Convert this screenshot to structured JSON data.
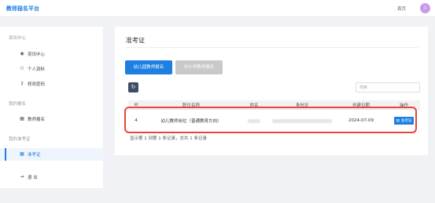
{
  "app": {
    "title": "教师报名平台"
  },
  "topbar": {
    "home_label": "首页",
    "avatar_initial": "I",
    "avatar_color": "#c79be8"
  },
  "sidebar": {
    "sections": [
      {
        "label": "资讯中心"
      },
      {
        "label": "我的报名"
      },
      {
        "label": "我的准考证"
      }
    ],
    "items": [
      {
        "label": "资讯中心",
        "icon": "user-circle-icon"
      },
      {
        "label": "个人资料",
        "icon": "person-icon"
      },
      {
        "label": "修改密码",
        "icon": "key-icon"
      },
      {
        "label": "教师报名",
        "icon": "calendar-icon"
      },
      {
        "label": "准考证",
        "icon": "calendar-icon",
        "active": true
      },
      {
        "label": "退 出",
        "icon": "logout-icon"
      }
    ]
  },
  "main": {
    "title": "准考证",
    "tabs": [
      {
        "label": "幼儿园教师报名",
        "active": true
      },
      {
        "label": "中小学教师报名",
        "active": false
      }
    ],
    "search": {
      "placeholder": "搜索",
      "value": ""
    },
    "table": {
      "columns": [
        "Id",
        "职位名称",
        "姓名",
        "身份证",
        "创建日期",
        "操作"
      ],
      "rows": [
        {
          "id": "4",
          "job": "幼儿教师岗位（普通教育方向）",
          "name": "",
          "id_card": "",
          "date": "2024-07-09",
          "action": "准考证"
        }
      ]
    },
    "pagination_text": "显示第 1 到第 1 条记录，总共 1 条记录"
  },
  "colors": {
    "accent": "#1e7fe0",
    "highlight": "#e8463a"
  }
}
